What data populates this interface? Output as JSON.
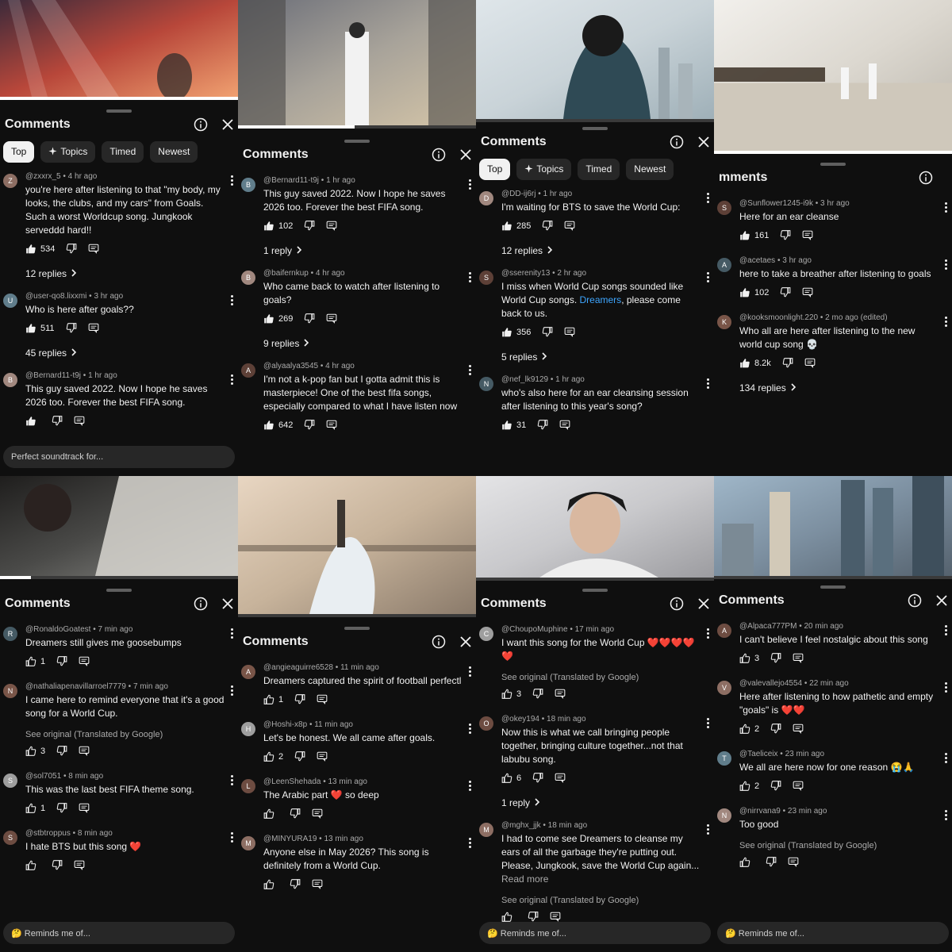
{
  "sheet": {
    "title": "Comments"
  },
  "p1": {
    "chips": [
      "Top",
      "Topics",
      "Timed",
      "Newest"
    ],
    "comments": [
      {
        "author": "@zxxrx_5",
        "time": "4 hr ago",
        "text": "you're here after listening to that \"my body, my looks, the clubs, and my cars\" from Goals. Such a worst Worldcup song. Jungkook serveddd hard!!",
        "likes": "534",
        "replies": "12 replies"
      },
      {
        "author": "@user-qo8.lixxmi",
        "time": "3 hr ago",
        "text": "Who is here after goals??",
        "likes": "511",
        "replies": "45 replies"
      },
      {
        "author": "@Bernard11-t9j",
        "time": "1 hr ago",
        "text": "This guy saved 2022. Now I hope he saves 2026 too. Forever the best FIFA song.",
        "likes": "",
        "replies": ""
      }
    ],
    "compose": "Perfect soundtrack for..."
  },
  "p2": {
    "comments": [
      {
        "author": "@Bernard11-t9j",
        "time": "1 hr ago",
        "text": "This guy saved 2022. Now I hope he saves 2026 too. Forever the best FIFA song.",
        "likes": "102",
        "replies": "1 reply"
      },
      {
        "author": "@baifernkup",
        "time": "4 hr ago",
        "text": "Who came back to watch after listening to goals?",
        "likes": "269",
        "replies": "9 replies"
      },
      {
        "author": "@alyaalya3545",
        "time": "4 hr ago",
        "text": "I'm not a k-pop fan but I gotta admit this is masterpiece! One of the best fifa songs, especially compared to what I have listen now",
        "likes": "642",
        "replies": ""
      }
    ]
  },
  "p3": {
    "chips": [
      "Top",
      "Topics",
      "Timed",
      "Newest"
    ],
    "comments": [
      {
        "author": "@DD-ij6rj",
        "time": "1 hr ago",
        "text": "I'm waiting for BTS to save the World Cup:",
        "likes": "285",
        "replies": "12 replies"
      },
      {
        "author": "@sserenity13",
        "time": "2 hr ago",
        "text_pre": "I miss when World Cup songs sounded like World Cup songs. ",
        "link": "Dreamers",
        "text_post": ", please come back to us.",
        "likes": "356",
        "replies": "5 replies"
      },
      {
        "author": "@nef_lk9129",
        "time": "1 hr ago",
        "text": "who's also here for an ear cleansing session after listening to this year's song?",
        "likes": "31",
        "replies": ""
      }
    ]
  },
  "p4": {
    "title_partial": "mments",
    "comments": [
      {
        "author": "@Sunflower1245-i9k",
        "time": "3 hr ago",
        "text": "Here for an ear cleanse",
        "likes": "161",
        "replies": ""
      },
      {
        "author": "@acetaes",
        "time": "3 hr ago",
        "text": "here to take a breather after listening to goals",
        "likes": "102",
        "replies": ""
      },
      {
        "author": "@kooksmoonlight.220",
        "time": "2 mo ago (edited)",
        "text": "Who all are here after listening to the new world cup song 💀",
        "likes": "8.2k",
        "replies": "134 replies"
      }
    ]
  },
  "p5": {
    "comments": [
      {
        "author": "@RonaldoGoatest",
        "time": "7 min ago",
        "text": "Dreamers still gives me goosebumps",
        "likes": "1",
        "translate": ""
      },
      {
        "author": "@nathaliapenavillarroel7779",
        "time": "7 min ago",
        "text": "I came here to remind everyone that it's a good song for a World Cup.",
        "likes": "3",
        "translate": "See original (Translated by Google)"
      },
      {
        "author": "@sol7051",
        "time": "8 min ago",
        "text": "This was the last best FIFA theme song.",
        "likes": "1",
        "translate": ""
      },
      {
        "author": "@stbtroppus",
        "time": "8 min ago",
        "text": "I hate BTS but this song ❤️",
        "likes": "",
        "translate": ""
      }
    ],
    "compose": "🤔 Reminds me of..."
  },
  "p6": {
    "comments": [
      {
        "author": "@angieaguirre6528",
        "time": "11 min ago",
        "text": "Dreamers captured the spirit of football perfectl",
        "likes": "1"
      },
      {
        "author": "@Hoshi-x8p",
        "time": "11 min ago",
        "text": "Let's be honest. We all came after goals.",
        "likes": "2"
      },
      {
        "author": "@LeenShehada",
        "time": "13 min ago",
        "text": "The Arabic part ❤️ so deep",
        "likes": ""
      },
      {
        "author": "@MINYURA19",
        "time": "13 min ago",
        "text": "Anyone else in May 2026? This song is definitely from a World Cup.",
        "likes": ""
      }
    ]
  },
  "p7": {
    "comments": [
      {
        "author": "@ChoupoMuphine",
        "time": "17 min ago",
        "text": "I want this song for the World Cup ❤️❤️❤️❤️❤️",
        "likes": "3",
        "translate": "See original (Translated by Google)",
        "replies": ""
      },
      {
        "author": "@okey194",
        "time": "18 min ago",
        "text": "Now this is what we call bringing people together, bringing culture together...not that labubu song.",
        "likes": "6",
        "translate": "",
        "replies": "1 reply"
      },
      {
        "author": "@mghx_jjk",
        "time": "18 min ago",
        "text": "I had to come see Dreamers to cleanse my ears of all the garbage they're putting out. Please, Jungkook, save the World Cup again...",
        "readmore": "Read more",
        "likes": "",
        "translate": "See original (Translated by Google)",
        "replies": ""
      }
    ],
    "compose": "🤔 Reminds me of..."
  },
  "p8": {
    "comments": [
      {
        "author": "@Alpaca777PM",
        "time": "20 min ago",
        "text": "I can't believe I feel nostalgic about this song",
        "likes": "3",
        "translate": ""
      },
      {
        "author": "@valevallejo4554",
        "time": "22 min ago",
        "text": "Here after listening to how pathetic and empty \"goals\" is ❤️❤️",
        "likes": "2",
        "translate": ""
      },
      {
        "author": "@Taeliceix",
        "time": "23 min ago",
        "text": "We all are here now for one reason 😭🙏",
        "likes": "2",
        "translate": ""
      },
      {
        "author": "@nirrvana9",
        "time": "23 min ago",
        "text": "Too good",
        "likes": "",
        "translate": "See original (Translated by Google)"
      }
    ],
    "compose": "🤔 Reminds me of..."
  },
  "colors": {
    "bg": "#0f0f0f",
    "chip": "#272727",
    "link": "#3ea6ff",
    "meta": "#aaaaaa"
  },
  "icons": [
    "thumb-up-icon",
    "thumb-down-icon",
    "comment-icon",
    "info-icon",
    "close-icon",
    "more-vert-icon",
    "sparkle-icon"
  ]
}
